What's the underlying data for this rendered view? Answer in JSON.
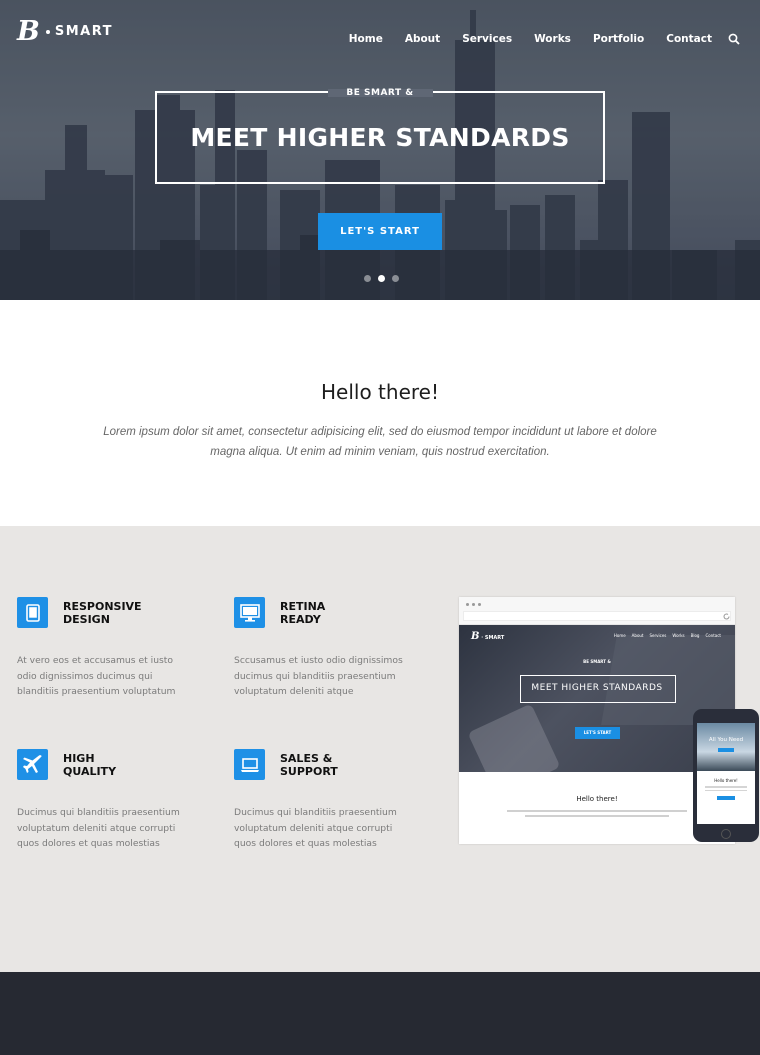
{
  "brand": {
    "initial": "B",
    "name": "SMART"
  },
  "nav": {
    "items": [
      "Home",
      "About",
      "Services",
      "Works",
      "Portfolio",
      "Contact"
    ]
  },
  "hero": {
    "eyebrow": "BE SMART &",
    "headline": "MEET HIGHER STANDARDS",
    "cta_label": "LET'S START",
    "slider_dots": 3,
    "active_slide": 2
  },
  "intro": {
    "title": "Hello there!",
    "text": "Lorem ipsum dolor sit amet, consectetur adipisicing elit, sed do eiusmod tempor incididunt ut labore et dolore magna aliqua. Ut enim ad minim veniam, quis nostrud exercitation."
  },
  "features": [
    {
      "icon": "tablet-icon",
      "title_line1": "RESPONSIVE",
      "title_line2": "DESIGN",
      "text": "At vero eos et accusamus et iusto odio dignissimos ducimus qui blanditiis praesentium voluptatum"
    },
    {
      "icon": "monitor-icon",
      "title_line1": "RETINA",
      "title_line2": "READY",
      "text": "Sccusamus et iusto odio dignissimos ducimus qui blanditiis praesentium voluptatum deleniti atque"
    },
    {
      "icon": "airplane-icon",
      "title_line1": "HIGH",
      "title_line2": "QUALITY",
      "text": "Ducimus qui blanditiis praesentium voluptatum deleniti atque corrupti quos dolores et quas molestias"
    },
    {
      "icon": "laptop-icon",
      "title_line1": "SALES &",
      "title_line2": "SUPPORT",
      "text": "Ducimus qui blanditiis praesentium voluptatum deleniti atque corrupti quos dolores et quas molestias"
    }
  ],
  "mockup": {
    "logo_initial": "B",
    "logo_name": "SMART",
    "nav": [
      "Home",
      "About",
      "Services",
      "Works",
      "Blog",
      "Contact"
    ],
    "eyebrow": "BE SMART &",
    "headline": "MEET HIGHER STANDARDS",
    "cta_label": "LET'S START",
    "hello": "Hello there!",
    "phone_title": "All You Need",
    "phone_hello": "Hello there!"
  },
  "colors": {
    "accent": "#1a8fe3",
    "features_bg": "#e8e6e4",
    "footer_bg": "#262932"
  }
}
